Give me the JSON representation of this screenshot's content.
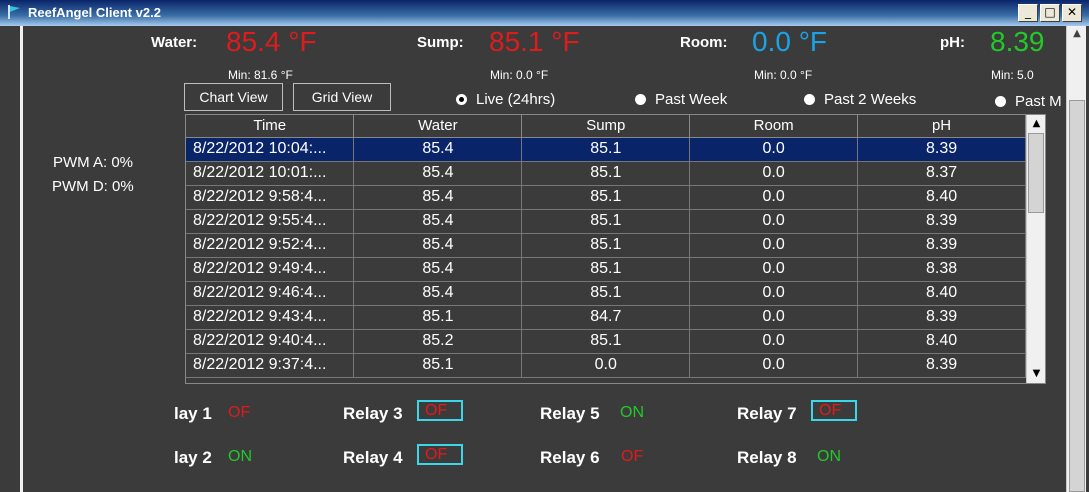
{
  "window": {
    "title": "ReefAngel Client v2.2",
    "controls": [
      "_",
      "□",
      "✕"
    ]
  },
  "readouts": {
    "water": {
      "label": "Water:",
      "value": "85.4 °F",
      "min": "Min:  81.6 °F",
      "color": "#e01b1b"
    },
    "sump": {
      "label": "Sump:",
      "value": "85.1 °F",
      "min": "Min:  0.0 °F",
      "color": "#e01b1b"
    },
    "room": {
      "label": "Room:",
      "value": "0.0 °F",
      "min": "Min:  0.0 °F",
      "color": "#1aa3e6"
    },
    "ph": {
      "label": "pH:",
      "value": "8.39",
      "min": "Min:  5.0",
      "color": "#23c82a"
    }
  },
  "view_buttons": {
    "chart": "Chart View",
    "grid": "Grid View"
  },
  "ranges": [
    {
      "label": "Live (24hrs)",
      "selected": true
    },
    {
      "label": "Past Week",
      "selected": false
    },
    {
      "label": "Past 2 Weeks",
      "selected": false
    },
    {
      "label": "Past M",
      "selected": false
    }
  ],
  "pwm": {
    "a": "PWM A:  0%",
    "d": "PWM D:  0%"
  },
  "table": {
    "columns": [
      "Time",
      "Water",
      "Sump",
      "Room",
      "pH"
    ],
    "rows": [
      [
        "8/22/2012 10:04:...",
        "85.4",
        "85.1",
        "0.0",
        "8.39"
      ],
      [
        "8/22/2012 10:01:...",
        "85.4",
        "85.1",
        "0.0",
        "8.37"
      ],
      [
        "8/22/2012 9:58:4...",
        "85.4",
        "85.1",
        "0.0",
        "8.40"
      ],
      [
        "8/22/2012 9:55:4...",
        "85.4",
        "85.1",
        "0.0",
        "8.39"
      ],
      [
        "8/22/2012 9:52:4...",
        "85.4",
        "85.1",
        "0.0",
        "8.39"
      ],
      [
        "8/22/2012 9:49:4...",
        "85.4",
        "85.1",
        "0.0",
        "8.38"
      ],
      [
        "8/22/2012 9:46:4...",
        "85.4",
        "85.1",
        "0.0",
        "8.40"
      ],
      [
        "8/22/2012 9:43:4...",
        "85.1",
        "84.7",
        "0.0",
        "8.39"
      ],
      [
        "8/22/2012 9:40:4...",
        "85.2",
        "85.1",
        "0.0",
        "8.40"
      ],
      [
        "8/22/2012 9:37:4...",
        "85.1",
        "0.0",
        "0.0",
        "8.39"
      ]
    ],
    "selected_row": 0
  },
  "relays": [
    {
      "label": "lay 1",
      "state": "OF",
      "boxed": false,
      "color": "red"
    },
    {
      "label": "lay 2",
      "state": "ON",
      "boxed": false,
      "color": "green"
    },
    {
      "label": "Relay 3",
      "state": "OF",
      "boxed": true,
      "color": "red"
    },
    {
      "label": "Relay 4",
      "state": "OF",
      "boxed": true,
      "color": "red"
    },
    {
      "label": "Relay 5",
      "state": "ON",
      "boxed": false,
      "color": "green"
    },
    {
      "label": "Relay 6",
      "state": "OF",
      "boxed": false,
      "color": "red"
    },
    {
      "label": "Relay 7",
      "state": "OF",
      "boxed": true,
      "color": "red"
    },
    {
      "label": "Relay 8",
      "state": "ON",
      "boxed": false,
      "color": "green"
    }
  ]
}
